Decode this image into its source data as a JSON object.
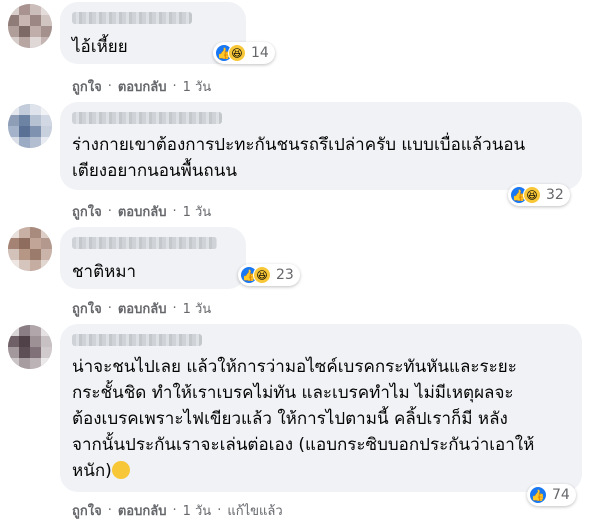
{
  "reaction_icons": {
    "like": "like-icon",
    "haha": "haha-icon"
  },
  "colors": {
    "bubble": "#f0f2f5",
    "meta": "#65676b",
    "like": "#1877f2",
    "haha": "#f7c737"
  },
  "comments": [
    {
      "text": "ไอ้เหี้ยย",
      "reactions": "14",
      "actions": {
        "like": "ถูกใจ",
        "reply": "ตอบกลับ",
        "time": "1 วัน"
      }
    },
    {
      "text": "ร่างกายเขาต้องการปะทะกันชนรถรึเปล่าครับ แบบเบื่อแล้วนอน\nเตียงอยากนอนพื้นถนน",
      "reactions": "32",
      "actions": {
        "like": "ถูกใจ",
        "reply": "ตอบกลับ",
        "time": "1 วัน"
      }
    },
    {
      "text": "ชาติหมา",
      "reactions": "23",
      "actions": {
        "like": "ถูกใจ",
        "reply": "ตอบกลับ",
        "time": "1 วัน"
      }
    },
    {
      "text": "น่าจะชนไปเลย แล้วให้การว่ามอไซค์เบรคกระทันหันและระยะ\nกระชั้นชิด ทำให้เราเบรคไม่ทัน และเบรคทำไม ไม่มีเหตุผลจะ\nต้องเบรคเพราะไฟเขียวแล้ว ให้การไปตามนี้ คลิ้ปเราก็มี หลัง\nจากนั้นประกันเราจะเล่นต่อเอง (แอบกระซิบบอกประกันว่าเอาให้\nหนัก)",
      "reactions": "74",
      "actions": {
        "like": "ถูกใจ",
        "reply": "ตอบกลับ",
        "time": "1 วัน",
        "edited": "แก้ไขแล้ว"
      }
    }
  ]
}
